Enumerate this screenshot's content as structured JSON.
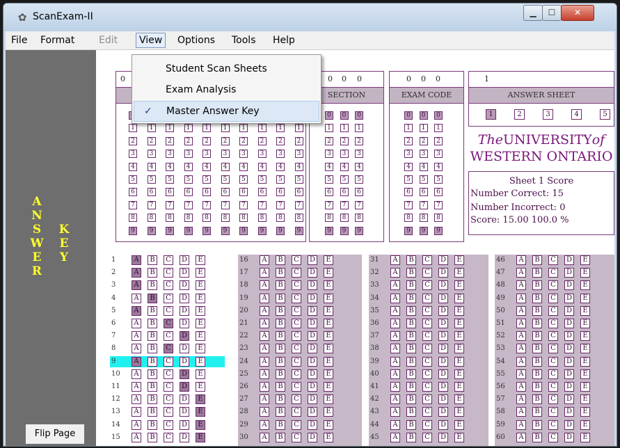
{
  "window": {
    "title": "ScanExam-II"
  },
  "menubar": {
    "items": [
      "File",
      "Format",
      "Edit",
      "View",
      "Options",
      "Tools",
      "Help"
    ]
  },
  "view_menu": {
    "items": [
      {
        "label": "Student Scan Sheets",
        "checked": false
      },
      {
        "label": "Exam Analysis",
        "checked": false
      },
      {
        "label": "Master Answer Key",
        "checked": true
      }
    ]
  },
  "sidebar": {
    "left_letters": [
      "A",
      "N",
      "S",
      "W",
      "E",
      "R"
    ],
    "right_letters": [
      "K",
      "E",
      "Y"
    ],
    "flip_button": "Flip Page"
  },
  "panels": {
    "id_digits": "0",
    "section": {
      "label": "SECTION",
      "digits": [
        "0",
        "0",
        "0"
      ]
    },
    "exam_code": {
      "label": "EXAM CODE",
      "digits": [
        "0",
        "0",
        "0"
      ]
    },
    "answer_sheet": {
      "label": "ANSWER SHEET",
      "value": "1",
      "sheets": [
        "1",
        "2",
        "3",
        "4",
        "5"
      ],
      "selected": "1"
    }
  },
  "university": {
    "the": "The",
    "university": "UNIVERSITY",
    "of": "of",
    "line2": "WESTERN ONTARIO"
  },
  "score": {
    "title": "Sheet 1 Score",
    "correct": "Number Correct: 15",
    "incorrect": "Number Incorrect: 0",
    "score": "Score: 15.00  100.0 %"
  },
  "digit_labels": [
    "0",
    "1",
    "2",
    "3",
    "4",
    "5",
    "6",
    "7",
    "8",
    "9"
  ],
  "choices": [
    "A",
    "B",
    "C",
    "D",
    "E"
  ],
  "answer_key": {
    "1": "A",
    "2": "A",
    "3": "A",
    "4": "B",
    "5": "A",
    "6": "C",
    "7": "D",
    "8": "C",
    "9": "A",
    "10": "D",
    "11": "D",
    "12": "E",
    "13": "E",
    "14": "E",
    "15": "E"
  },
  "highlighted_question": "9",
  "colors": {
    "accent": "#7a167a",
    "highlight": "#22f0f0",
    "sidebar_text": "#ffff2e"
  }
}
